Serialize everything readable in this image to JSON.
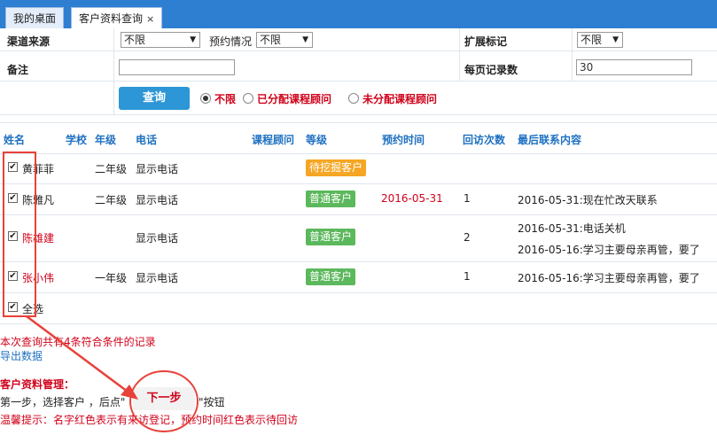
{
  "tabs": [
    {
      "label": "我的桌面"
    },
    {
      "label": "客户资料查询",
      "close": "×"
    }
  ],
  "filters": {
    "channel_label": "渠道来源",
    "channel_value": "不限",
    "appointment_label": "预约情况",
    "appointment_value": "不限",
    "ext_label": "扩展标记",
    "ext_value": "不限",
    "remark_label": "备注",
    "remark_value": "",
    "page_size_label": "每页记录数",
    "page_size_value": "30",
    "query_button": "查询",
    "radio_options": [
      "不限",
      "已分配课程顾问",
      "未分配课程顾问"
    ],
    "radio_selected": 0
  },
  "table": {
    "columns": [
      "姓名",
      "学校",
      "年级",
      "电话",
      "课程顾问",
      "等级",
      "预约时间",
      "回访次数",
      "最后联系内容"
    ],
    "rows": [
      {
        "name": "黄菲菲",
        "grade": "二年级",
        "phone": "显示电话",
        "level": "待挖掘客户",
        "level_color": "#f5a623",
        "appointment": "",
        "visits": "",
        "contacts": [],
        "checked": true,
        "name_red": false
      },
      {
        "name": "陈雅凡",
        "grade": "二年级",
        "phone": "显示电话",
        "level": "普通客户",
        "level_color": "#5cb85c",
        "appointment": "2016-05-31",
        "visits": "1",
        "contacts": [
          "2016-05-31:现在忙改天联系"
        ],
        "checked": true,
        "name_red": false
      },
      {
        "name": "陈雄建",
        "grade": "",
        "phone": "显示电话",
        "level": "普通客户",
        "level_color": "#5cb85c",
        "appointment": "",
        "visits": "2",
        "contacts": [
          "2016-05-31:电话关机",
          "2016-05-16:学习主要母亲再管，要了"
        ],
        "checked": true,
        "name_red": true
      },
      {
        "name": "张小伟",
        "grade": "一年级",
        "phone": "显示电话",
        "level": "普通客户",
        "level_color": "#5cb85c",
        "appointment": "",
        "visits": "1",
        "contacts": [
          "2016-05-16:学习主要母亲再管，要了"
        ],
        "checked": true,
        "name_red": true
      }
    ],
    "select_all_label": "全选",
    "select_all_checked": true
  },
  "footer": {
    "result_text": "本次查询共有4条符合条件的记录",
    "export_link": "导出数据",
    "section_title": "客户资料管理：",
    "step_prefix": "第一步，选择客户 ，后点\"",
    "next_button": "下一步",
    "step_suffix": "\"按钮",
    "tip": "温馨提示：名字红色表示有来访登记，预约时间红色表示待回访"
  },
  "colors": {
    "tabbar": "#2e7fd2",
    "link": "#1e70c1",
    "alert": "#d0021b",
    "annotation": "#e8413a"
  }
}
